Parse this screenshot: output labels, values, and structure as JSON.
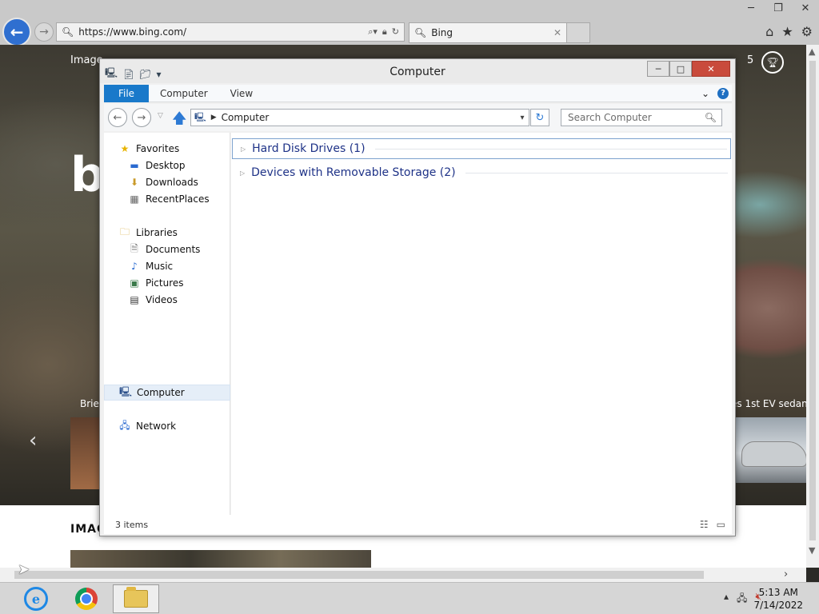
{
  "browser": {
    "url": "https://www.bing.com/",
    "tab_title": "Bing",
    "window_controls": [
      "─",
      "❐",
      "✕"
    ]
  },
  "bing": {
    "nav_left": "Image",
    "reward_count": "5",
    "news_left": "Brie",
    "news_right": "es 1st EV sedan",
    "section_heading": "IMAG"
  },
  "explorer": {
    "title": "Computer",
    "ribbon_tabs": {
      "file": "File",
      "computer": "Computer",
      "view": "View"
    },
    "address_path": "Computer",
    "search_placeholder": "Search Computer",
    "nav": {
      "favorites": "Favorites",
      "desktop": "Desktop",
      "downloads": "Downloads",
      "recent_places": "RecentPlaces",
      "libraries": "Libraries",
      "documents": "Documents",
      "music": "Music",
      "pictures": "Pictures",
      "videos": "Videos",
      "computer": "Computer",
      "network": "Network"
    },
    "groups": [
      {
        "label": "Hard Disk Drives (1)"
      },
      {
        "label": "Devices with Removable Storage (2)"
      }
    ],
    "status": "3 items"
  },
  "taskbar": {
    "time": "5:13 AM",
    "date": "7/14/2022"
  }
}
